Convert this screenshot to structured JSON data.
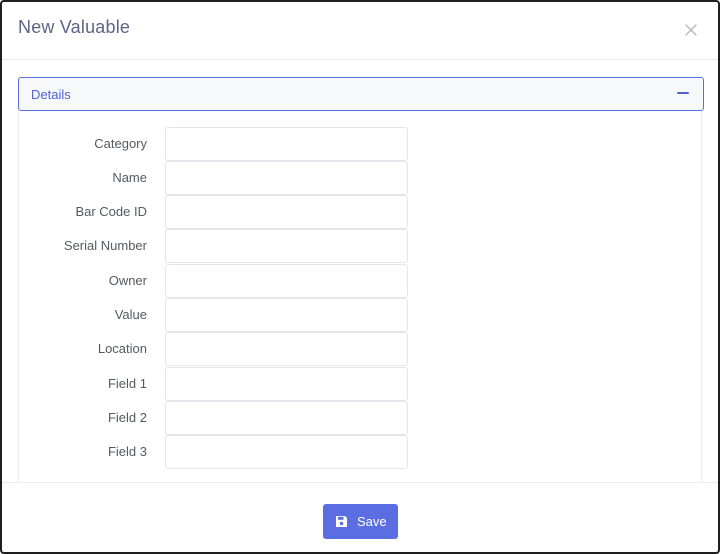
{
  "modal": {
    "title": "New Valuable",
    "close_icon": "close-icon"
  },
  "panel": {
    "title": "Details",
    "toggle_icon": "minus-icon"
  },
  "fields": [
    {
      "label": "Category",
      "value": "",
      "placeholder": ""
    },
    {
      "label": "Name",
      "value": "",
      "placeholder": ""
    },
    {
      "label": "Bar Code ID",
      "value": "",
      "placeholder": ""
    },
    {
      "label": "Serial Number",
      "value": "",
      "placeholder": ""
    },
    {
      "label": "Owner",
      "value": "",
      "placeholder": ""
    },
    {
      "label": "Value",
      "value": "",
      "placeholder": ""
    },
    {
      "label": "Location",
      "value": "",
      "placeholder": ""
    },
    {
      "label": "Field 1",
      "value": "",
      "placeholder": ""
    },
    {
      "label": "Field 2",
      "value": "",
      "placeholder": ""
    },
    {
      "label": "Field 3",
      "value": "",
      "placeholder": ""
    }
  ],
  "footer": {
    "save_label": "Save",
    "save_icon": "floppy-disk-icon"
  },
  "colors": {
    "accent": "#5b6ee1",
    "title": "#5d6487",
    "label": "#575962",
    "border": "#e2e5ec"
  }
}
